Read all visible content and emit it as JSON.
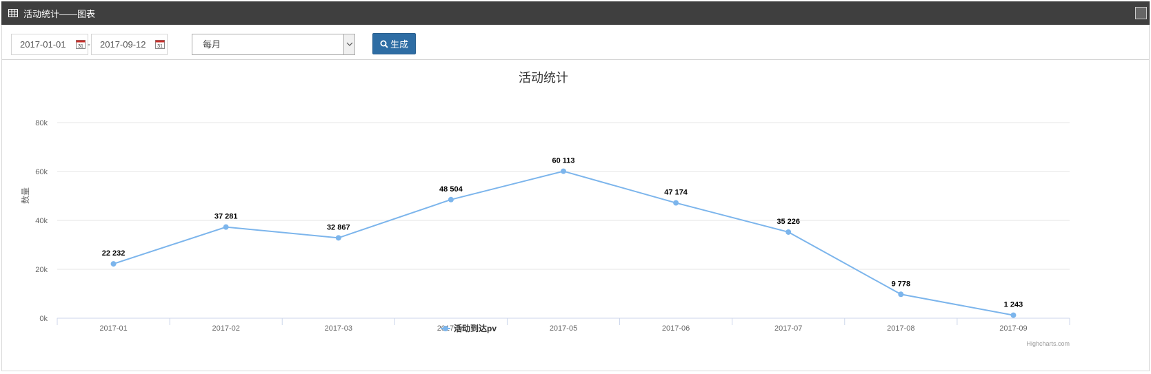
{
  "window": {
    "title": "活动统计——图表",
    "grid_icon": "table-icon"
  },
  "toolbar": {
    "start_date": "2017-01-01",
    "end_date": "2017-09-12",
    "separator": "-",
    "period_select": "每月",
    "generate_label": "生成",
    "generate_icon": "search-icon",
    "generate_color": "#2e6da4"
  },
  "chart_data": {
    "type": "line",
    "title": "活动统计",
    "xlabel": "",
    "ylabel": "数量",
    "categories": [
      "2017-01",
      "2017-02",
      "2017-03",
      "2017-04",
      "2017-05",
      "2017-06",
      "2017-07",
      "2017-08",
      "2017-09"
    ],
    "series": [
      {
        "name": "活动到达pv",
        "color": "#7cb5ec",
        "values": [
          22232,
          37281,
          32867,
          48504,
          60113,
          47174,
          35226,
          9778,
          1243
        ],
        "labels": [
          "22 232",
          "37 281",
          "32 867",
          "48 504",
          "60 113",
          "47 174",
          "35 226",
          "9 778",
          "1 243"
        ]
      }
    ],
    "ylim": [
      0,
      80000
    ],
    "yticks": [
      0,
      20000,
      40000,
      60000,
      80000
    ],
    "ytick_labels": [
      "0k",
      "20k",
      "40k",
      "60k",
      "80k"
    ],
    "grid": true,
    "legend_position": "bottom-center",
    "credits": "Highcharts.com"
  }
}
